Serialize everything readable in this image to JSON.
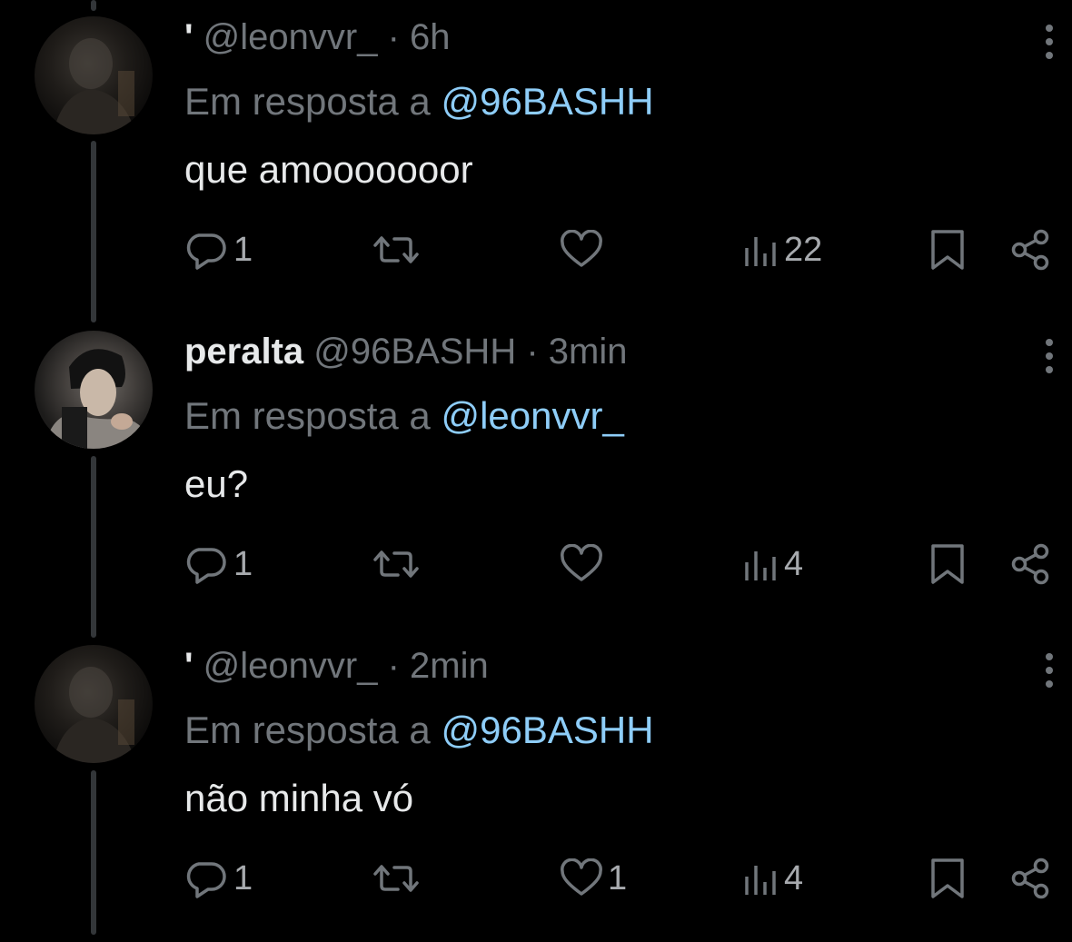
{
  "colors": {
    "background": "#000000",
    "text_primary": "#e7e9ea",
    "text_secondary": "#71767b",
    "link": "#8ecdf8",
    "thread_line": "#333639"
  },
  "posts": [
    {
      "display_name": "'",
      "handle": "@leonvvr_",
      "separator": "·",
      "time": "6h",
      "reply_prefix": "Em resposta a",
      "reply_to": "@96BASHH",
      "text": "que amooooooor",
      "replies": "1",
      "reposts": "",
      "likes": "",
      "views": "22",
      "icons": [
        "reply-icon",
        "repost-icon",
        "like-icon",
        "views-icon",
        "bookmark-icon",
        "share-icon",
        "more-icon"
      ]
    },
    {
      "display_name": "peralta",
      "handle": "@96BASHH",
      "separator": "·",
      "time": "3min",
      "reply_prefix": "Em resposta a",
      "reply_to": "@leonvvr_",
      "text": "eu?",
      "replies": "1",
      "reposts": "",
      "likes": "",
      "views": "4",
      "icons": [
        "reply-icon",
        "repost-icon",
        "like-icon",
        "views-icon",
        "bookmark-icon",
        "share-icon",
        "more-icon"
      ]
    },
    {
      "display_name": "'",
      "handle": "@leonvvr_",
      "separator": "·",
      "time": "2min",
      "reply_prefix": "Em resposta a",
      "reply_to": "@96BASHH",
      "text": "não minha vó",
      "replies": "1",
      "reposts": "",
      "likes": "1",
      "views": "4",
      "icons": [
        "reply-icon",
        "repost-icon",
        "like-icon",
        "views-icon",
        "bookmark-icon",
        "share-icon",
        "more-icon"
      ]
    }
  ]
}
